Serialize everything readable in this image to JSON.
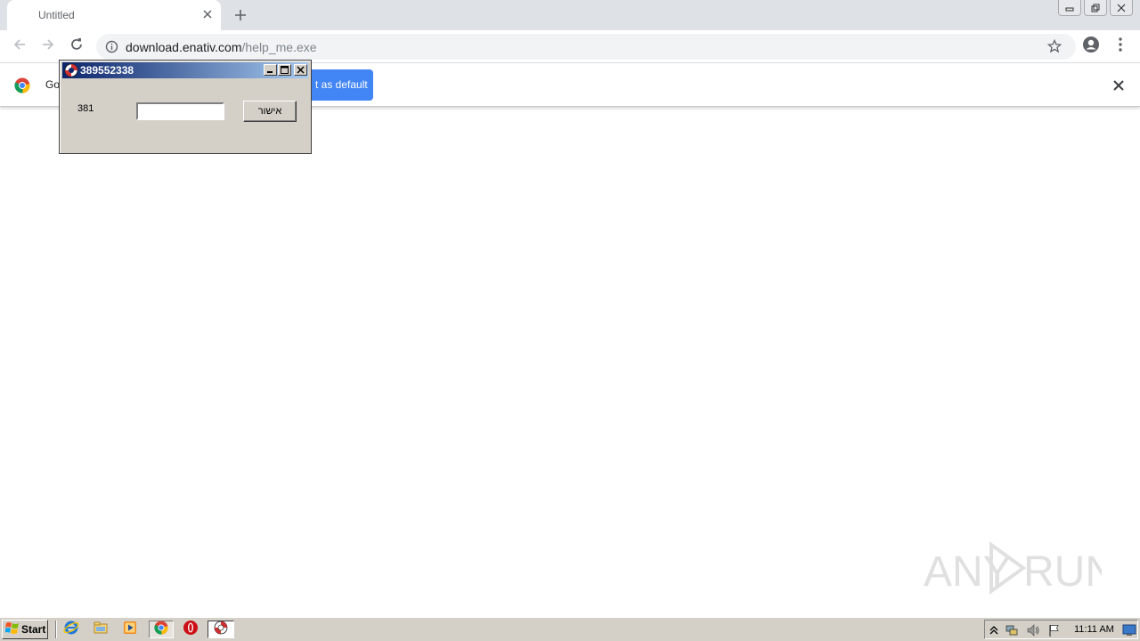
{
  "browser": {
    "tab_title": "Untitled",
    "url_host": "download.enativ.com",
    "url_path": "/help_me.exe"
  },
  "infobar": {
    "message": "Go",
    "button_label": "t as default"
  },
  "dialog": {
    "title": "389552338",
    "label": "381",
    "input_value": "",
    "ok_button": "אישור"
  },
  "watermark": {
    "text_left": "ANY",
    "text_right": "RUN"
  },
  "taskbar": {
    "start_label": "Start",
    "clock": "11:11 AM",
    "pinned": [
      "internet-explorer-icon",
      "folder-icon",
      "media-player-icon",
      "chrome-icon",
      "opera-icon"
    ],
    "active_app_icon": "lifebuoy-icon"
  },
  "colors": {
    "accent": "#4285f4",
    "dialog_title_start": "#0a246a",
    "dialog_title_end": "#a6caf0"
  }
}
